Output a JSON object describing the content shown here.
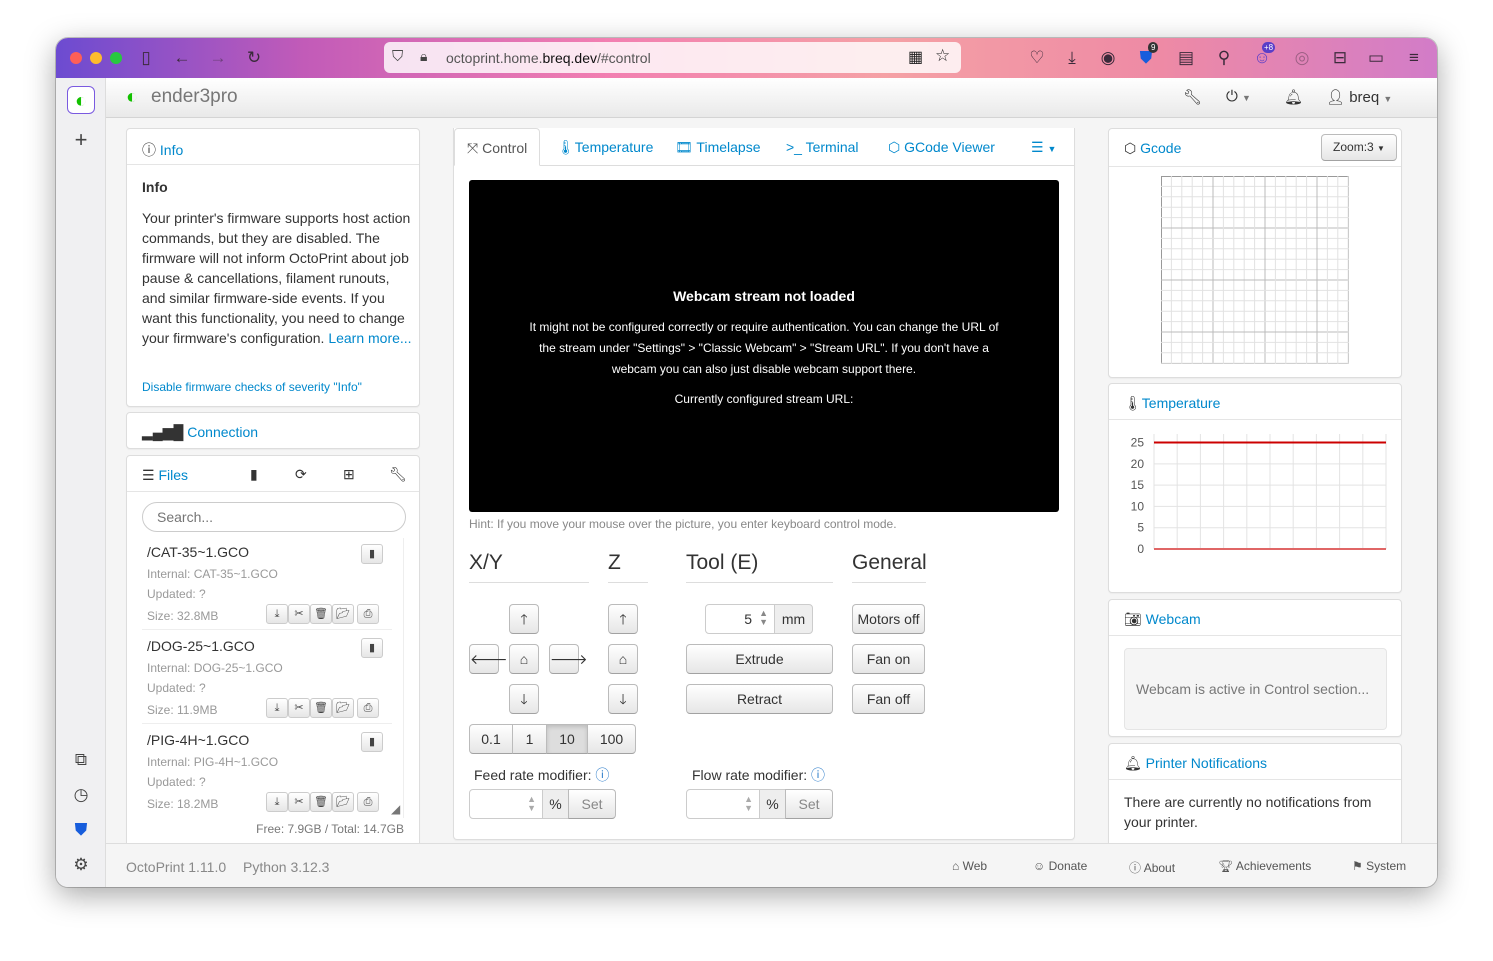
{
  "browser": {
    "url_prefix": "octoprint.home.",
    "url_domain": "breq.dev",
    "url_suffix": "/#control",
    "badge_bitwarden": "9",
    "badge_ext": "+8"
  },
  "navbar": {
    "brand": "ender3pro",
    "user": "breq"
  },
  "info_panel": {
    "header": "Info",
    "title": "Info",
    "body": "Your printer's firmware supports host action commands, but they are disabled. The firmware will not inform OctoPrint about job pause & cancellations, filament runouts, and similar firmware-side events. If you want this functionality, you need to change your firmware's configuration.",
    "learn_more": "Learn more...",
    "disable_link": "Disable firmware checks of severity \"Info\""
  },
  "connection_panel": {
    "header": "Connection"
  },
  "files_panel": {
    "header": "Files",
    "search_placeholder": "Search...",
    "files": [
      {
        "name": "/CAT-35~1.GCO",
        "internal": "Internal: CAT-35~1.GCO",
        "updated": "Updated: ?",
        "size": "Size: 32.8MB"
      },
      {
        "name": "/DOG-25~1.GCO",
        "internal": "Internal: DOG-25~1.GCO",
        "updated": "Updated: ?",
        "size": "Size: 11.9MB"
      },
      {
        "name": "/PIG-4H~1.GCO",
        "internal": "Internal: PIG-4H~1.GCO",
        "updated": "Updated: ?",
        "size": "Size: 18.2MB"
      }
    ],
    "free_total": "Free: 7.9GB / Total: 14.7GB"
  },
  "tabs": {
    "control": "Control",
    "temperature": "Temperature",
    "timelapse": "Timelapse",
    "terminal": "Terminal",
    "gcode_viewer": "GCode Viewer"
  },
  "webcam": {
    "title": "Webcam stream not loaded",
    "message": "It might not be configured correctly or require authentication. You can change the URL of the stream under \"Settings\" > \"Classic Webcam\" > \"Stream URL\". If you don't have a webcam you can also just disable webcam support there.",
    "configured": "Currently configured stream URL:",
    "hint": "Hint: If you move your mouse over the picture, you enter keyboard control mode."
  },
  "jog": {
    "xy_title": "X/Y",
    "z_title": "Z",
    "tool_title": "Tool (E)",
    "general_title": "General",
    "steps": [
      "0.1",
      "1",
      "10",
      "100"
    ],
    "selected_step": "10",
    "extrude_amount": "5",
    "mm": "mm",
    "extrude": "Extrude",
    "retract": "Retract",
    "motors_off": "Motors off",
    "fan_on": "Fan on",
    "fan_off": "Fan off",
    "feed_rate_label": "Feed rate modifier:",
    "flow_rate_label": "Flow rate modifier:",
    "percent": "%",
    "set": "Set"
  },
  "gcode_panel": {
    "header": "Gcode",
    "zoom": "Zoom:3"
  },
  "temperature_panel": {
    "header": "Temperature",
    "y_ticks": [
      "25",
      "20",
      "15",
      "10",
      "5",
      "0"
    ],
    "series_color_1": "#cc0000",
    "series_color_2": "#e06666"
  },
  "chart_data": {
    "type": "line",
    "title": "",
    "xlabel": "",
    "ylabel": "",
    "ylim": [
      0,
      27
    ],
    "series": [
      {
        "values": [
          25,
          25,
          25,
          25,
          25,
          25,
          25,
          25,
          25,
          25,
          25
        ]
      },
      {
        "values": [
          0,
          0,
          0,
          0,
          0,
          0,
          0,
          0,
          0,
          0,
          0
        ]
      }
    ]
  },
  "webcam_panel": {
    "header": "Webcam",
    "message": "Webcam is active in Control section..."
  },
  "notifications_panel": {
    "header": "Printer Notifications",
    "message": "There are currently no notifications from your printer."
  },
  "footer": {
    "version": "OctoPrint 1.11.0",
    "python": "Python 3.12.3",
    "web": "Web",
    "donate": "Donate",
    "about": "About",
    "achievements": "Achievements",
    "system": "System"
  }
}
